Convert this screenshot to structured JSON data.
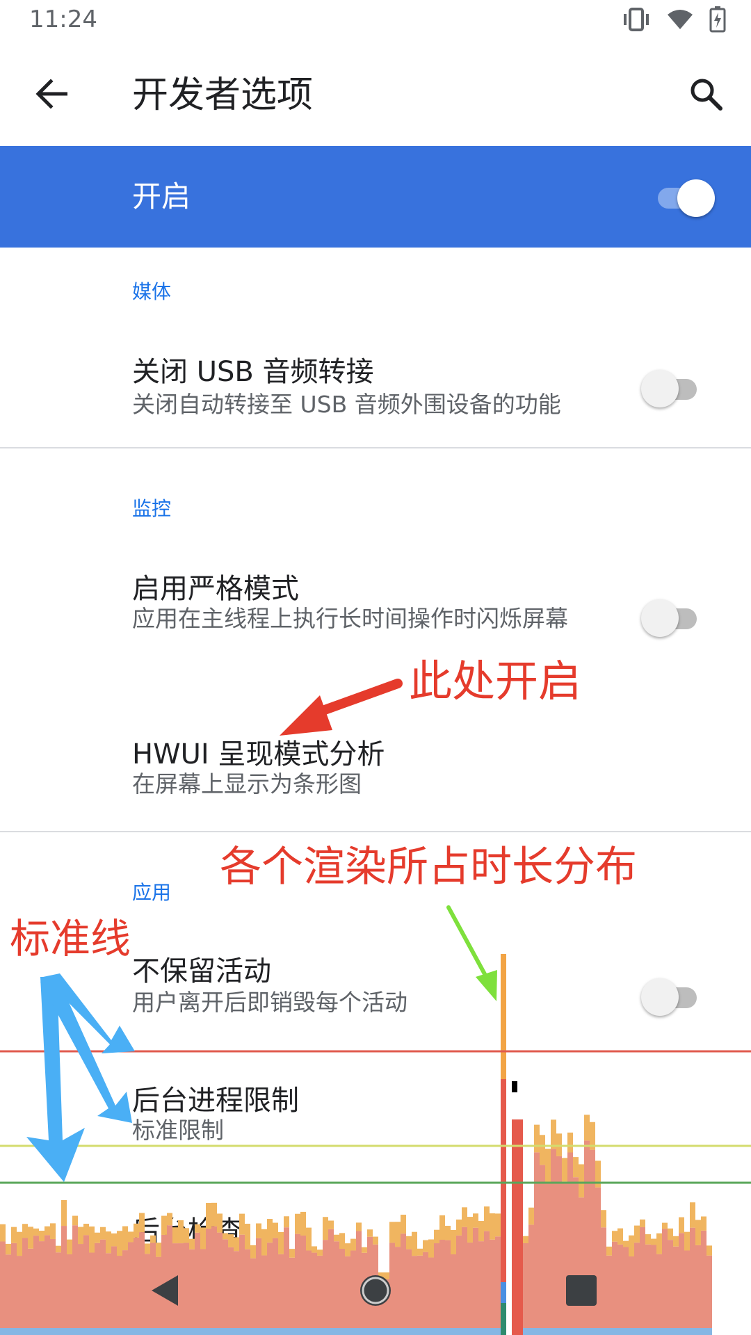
{
  "status_bar": {
    "time": "11:24",
    "icons": [
      "vibrate-icon",
      "wifi-icon",
      "battery-charging-icon"
    ]
  },
  "toolbar": {
    "title": "开发者选项",
    "back_icon": "arrow-back-icon",
    "search_icon": "search-icon"
  },
  "master": {
    "label": "开启",
    "enabled": true,
    "accent": "#3872dd"
  },
  "sections": [
    {
      "category": "媒体",
      "items": [
        {
          "title": "关闭 USB 音频转接",
          "summary": "关闭自动转接至 USB 音频外围设备的功能",
          "switch": "off"
        }
      ]
    },
    {
      "category": "监控",
      "items": [
        {
          "title": "启用严格模式",
          "summary": "应用在主线程上执行长时间操作时闪烁屏幕",
          "switch": "off"
        },
        {
          "title": "HWUI 呈现模式分析",
          "summary": "在屏幕上显示为条形图"
        }
      ]
    },
    {
      "category": "应用",
      "items": [
        {
          "title": "不保留活动",
          "summary": "用户离开后即销毁每个活动",
          "switch": "off"
        },
        {
          "title": "后台进程限制",
          "summary": "标准限制"
        },
        {
          "title": "后台检查"
        }
      ]
    }
  ],
  "annotations": {
    "enable_here": "此处开启",
    "render_distribution": "各个渲染所占时长分布",
    "standard_line": "标准线",
    "colors": {
      "text": "#e53b2c",
      "green_arrow": "#7ee03c",
      "blue_arrow": "#4aaff5"
    }
  },
  "profiler": {
    "line_colors": {
      "red": "#e05a4e",
      "yellow": "#d4dc6e",
      "green": "#5aa65a"
    },
    "bar_colors": {
      "base": "#e8907f",
      "top": "#f0b560",
      "spike_orange": "#f2a445",
      "spike_red": "#e55a4c",
      "spike_blue": "#4a90e2",
      "spike_green": "#2e8b6e"
    }
  },
  "nav_bar": {
    "icons": [
      "nav-back-icon",
      "nav-home-icon",
      "nav-recents-icon"
    ]
  }
}
